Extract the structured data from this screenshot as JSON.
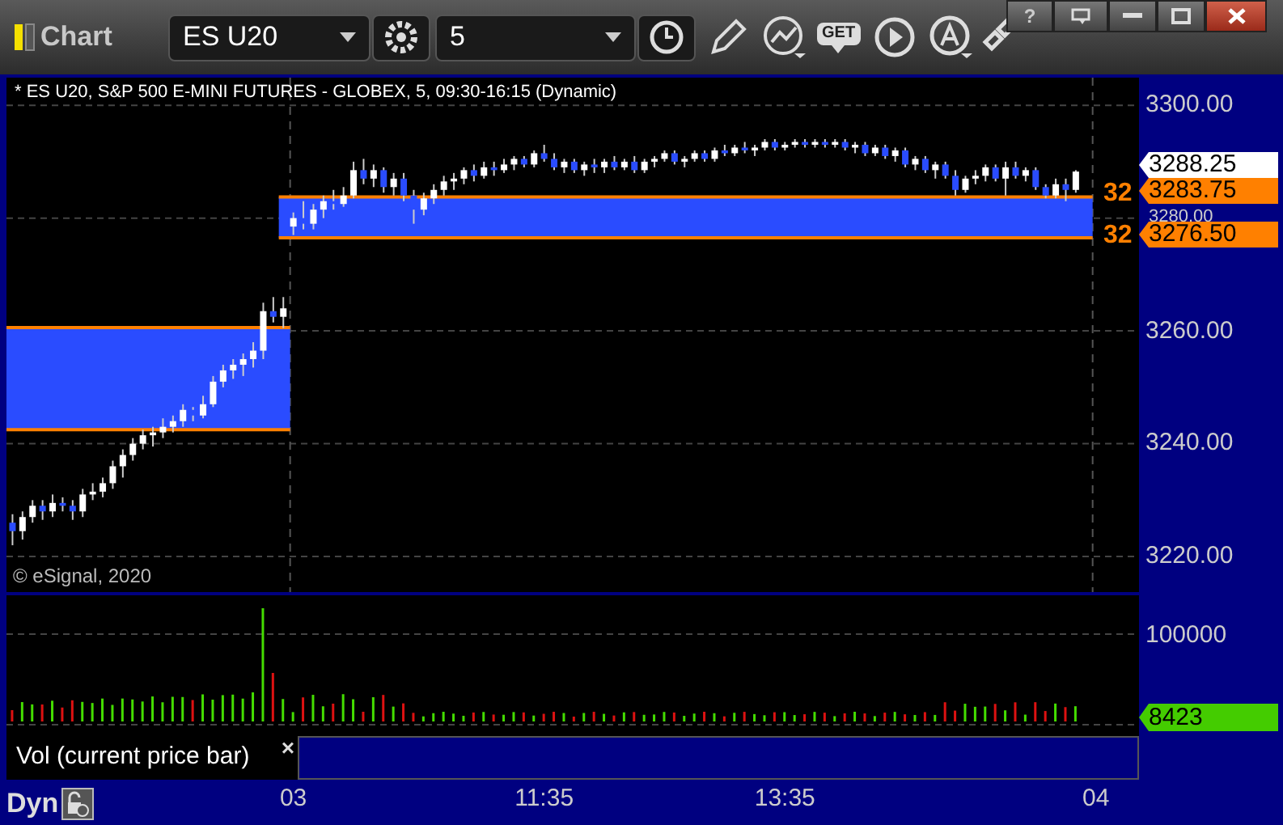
{
  "window": {
    "title": "Chart",
    "help": "?"
  },
  "toolbar": {
    "symbol": "ES U20",
    "interval": "5",
    "get_label": "GET"
  },
  "chart": {
    "legend": "* ES U20, S&P 500 E-MINI FUTURES - GLOBEX, 5, 09:30-16:15 (Dynamic)",
    "copyright": "© eSignal, 2020",
    "chart_data": {
      "type": "candlestick",
      "categories": [
        null,
        null,
        null,
        null,
        null,
        null,
        null,
        null,
        null,
        null,
        null,
        null,
        null,
        null,
        null,
        null,
        null,
        null,
        null,
        null,
        null,
        null,
        null,
        null,
        null,
        null,
        null,
        null,
        null,
        null,
        null,
        null,
        null,
        null,
        null,
        null,
        null,
        null,
        null,
        null,
        null,
        null,
        null,
        null,
        null,
        null,
        null,
        null,
        null,
        null,
        null,
        null,
        null,
        null,
        null,
        null,
        null,
        null,
        null,
        null,
        null,
        null,
        null,
        null,
        null,
        null,
        null,
        null,
        null,
        null,
        null,
        null,
        null,
        null,
        null,
        null,
        null,
        null,
        null,
        null,
        null,
        null,
        null,
        null,
        null,
        null,
        null,
        null,
        null,
        null,
        null,
        null,
        null,
        null,
        null,
        null,
        null,
        null,
        null,
        null,
        null,
        null,
        null,
        null,
        null,
        null,
        null
      ],
      "ohlc": [
        [
          3226,
          3227.5,
          3222,
          3224.5
        ],
        [
          3224.5,
          3228,
          3223,
          3227
        ],
        [
          3227,
          3230,
          3226,
          3229
        ],
        [
          3229,
          3230,
          3226.5,
          3228
        ],
        [
          3228,
          3231,
          3227,
          3229.5
        ],
        [
          3229.5,
          3230.5,
          3228,
          3229
        ],
        [
          3229,
          3230,
          3226.5,
          3228
        ],
        [
          3228,
          3232,
          3227,
          3231
        ],
        [
          3231,
          3233,
          3230,
          3231.5
        ],
        [
          3231.5,
          3234,
          3230.5,
          3233
        ],
        [
          3233,
          3237,
          3232,
          3236
        ],
        [
          3236,
          3239,
          3234,
          3238
        ],
        [
          3238,
          3241,
          3237,
          3240
        ],
        [
          3240,
          3242.5,
          3239,
          3241.5
        ],
        [
          3241.5,
          3243,
          3239.5,
          3242
        ],
        [
          3242,
          3244.5,
          3241,
          3243
        ],
        [
          3243,
          3245,
          3242,
          3244
        ],
        [
          3244,
          3247,
          3243,
          3246
        ],
        [
          3246,
          3246.5,
          3244,
          3245
        ],
        [
          3245,
          3248.5,
          3244.5,
          3247
        ],
        [
          3247,
          3252,
          3246.5,
          3251
        ],
        [
          3251,
          3254,
          3250,
          3253
        ],
        [
          3253,
          3255,
          3251.5,
          3254
        ],
        [
          3254,
          3256,
          3252,
          3255
        ],
        [
          3255,
          3258,
          3253.5,
          3256.5
        ],
        [
          3256.5,
          3265,
          3255,
          3263.5
        ],
        [
          3263.5,
          3266,
          3261.5,
          3262.5
        ],
        [
          3262.5,
          3266,
          3260.5,
          3264
        ],
        [
          3278.5,
          3281,
          3277,
          3280
        ],
        [
          3280,
          3283,
          3278,
          3279
        ],
        [
          3279,
          3282.5,
          3278,
          3281.5
        ],
        [
          3281.5,
          3284,
          3280,
          3283
        ],
        [
          3283,
          3285,
          3281.5,
          3282.5
        ],
        [
          3282.5,
          3285.5,
          3282,
          3284
        ],
        [
          3284,
          3290,
          3283.5,
          3288.5
        ],
        [
          3288.5,
          3290.5,
          3286,
          3287
        ],
        [
          3287,
          3289.5,
          3285.5,
          3288.5
        ],
        [
          3288.5,
          3289,
          3284.5,
          3285.5
        ],
        [
          3285.5,
          3288,
          3284,
          3287
        ],
        [
          3287,
          3288,
          3283,
          3284
        ],
        [
          3284,
          3285,
          3279,
          3281.5
        ],
        [
          3281.5,
          3284.5,
          3280.5,
          3283.5
        ],
        [
          3283.5,
          3286,
          3282.5,
          3285
        ],
        [
          3285,
          3287.5,
          3284,
          3286.5
        ],
        [
          3286.5,
          3288,
          3285,
          3287
        ],
        [
          3287,
          3289,
          3286,
          3288.5
        ],
        [
          3288.5,
          3289.5,
          3286.5,
          3287.5
        ],
        [
          3287.5,
          3290,
          3287,
          3289
        ],
        [
          3289,
          3290,
          3287.5,
          3288.5
        ],
        [
          3288.5,
          3290.5,
          3288,
          3289.5
        ],
        [
          3289.5,
          3291,
          3288.5,
          3290.5
        ],
        [
          3290.5,
          3291,
          3289,
          3289.5
        ],
        [
          3289.5,
          3292,
          3289,
          3291.5
        ],
        [
          3291.5,
          3293,
          3290,
          3290.5
        ],
        [
          3290.5,
          3291.5,
          3288.5,
          3289
        ],
        [
          3289,
          3290.5,
          3288,
          3290
        ],
        [
          3290,
          3290.5,
          3288,
          3288.5
        ],
        [
          3288.5,
          3290,
          3287.5,
          3289.5
        ],
        [
          3289.5,
          3290.5,
          3288,
          3289
        ],
        [
          3289,
          3290.5,
          3288,
          3290
        ],
        [
          3290,
          3291,
          3288.5,
          3289
        ],
        [
          3289,
          3290.5,
          3288.5,
          3290
        ],
        [
          3290,
          3291,
          3288,
          3288.5
        ],
        [
          3288.5,
          3290.5,
          3288,
          3290
        ],
        [
          3290,
          3291,
          3289,
          3290.5
        ],
        [
          3290.5,
          3292,
          3290,
          3291.5
        ],
        [
          3291.5,
          3292,
          3289.5,
          3290
        ],
        [
          3290,
          3291,
          3289,
          3290.5
        ],
        [
          3290.5,
          3292,
          3290,
          3291.5
        ],
        [
          3291.5,
          3292,
          3290,
          3290.5
        ],
        [
          3290.5,
          3292.5,
          3290,
          3292
        ],
        [
          3292,
          3293,
          3291,
          3291.5
        ],
        [
          3291.5,
          3293,
          3291,
          3292.5
        ],
        [
          3292.5,
          3293.5,
          3291.5,
          3292
        ],
        [
          3292,
          3293,
          3291,
          3292.5
        ],
        [
          3292.5,
          3294,
          3292,
          3293.5
        ],
        [
          3293.5,
          3294,
          3292,
          3292.5
        ],
        [
          3292.5,
          3293.5,
          3292,
          3293
        ],
        [
          3293,
          3294,
          3292.5,
          3293.5
        ],
        [
          3293.5,
          3294,
          3292.5,
          3293
        ],
        [
          3293,
          3294,
          3292.5,
          3293.5
        ],
        [
          3293.5,
          3294,
          3292.5,
          3293
        ],
        [
          3293,
          3294,
          3292.5,
          3293.5
        ],
        [
          3293.5,
          3294,
          3292,
          3292.5
        ],
        [
          3292.5,
          3293.5,
          3291.5,
          3293
        ],
        [
          3293,
          3293.5,
          3291,
          3291.5
        ],
        [
          3291.5,
          3293,
          3291,
          3292.5
        ],
        [
          3292.5,
          3293,
          3290.5,
          3291
        ],
        [
          3291,
          3292.5,
          3290,
          3292
        ],
        [
          3292,
          3292.5,
          3289,
          3289.5
        ],
        [
          3289.5,
          3291,
          3288.5,
          3290.5
        ],
        [
          3290.5,
          3291,
          3288,
          3288.5
        ],
        [
          3288.5,
          3290,
          3287,
          3289.5
        ],
        [
          3289.5,
          3290,
          3287,
          3287.5
        ],
        [
          3287.5,
          3288.5,
          3284,
          3285
        ],
        [
          3285,
          3287.5,
          3284.5,
          3287
        ],
        [
          3287,
          3288.5,
          3286,
          3287.5
        ],
        [
          3287.5,
          3289.5,
          3286.5,
          3289
        ],
        [
          3289,
          3289.5,
          3286.5,
          3287
        ],
        [
          3287,
          3290,
          3284,
          3289
        ],
        [
          3289,
          3290,
          3287,
          3287.5
        ],
        [
          3287.5,
          3289,
          3286.5,
          3288.5
        ],
        [
          3288.5,
          3289,
          3285,
          3285.5
        ],
        [
          3285.5,
          3286,
          3283.5,
          3284
        ],
        [
          3284,
          3287,
          3283.5,
          3286
        ],
        [
          3286,
          3287,
          3283,
          3285
        ],
        [
          3285,
          3288.5,
          3284.5,
          3288.25
        ]
      ],
      "ylim": [
        3213.7,
        3304.9
      ],
      "grid": true,
      "yticks": [
        {
          "value": 3300,
          "label": "3300.00"
        },
        {
          "value": 3280,
          "label": "3280.00"
        },
        {
          "value": 3260,
          "label": "3260.00"
        },
        {
          "value": 3240,
          "label": "3240.00"
        },
        {
          "value": 3220,
          "label": "3220.00"
        }
      ]
    },
    "zone_labels": [
      "32",
      "32"
    ],
    "price_markers": [
      {
        "label": "3288.25",
        "color": "#ffffff"
      },
      {
        "label": "3283.75",
        "color": "#ff8000"
      },
      {
        "label": "3276.50",
        "color": "#ff8000"
      }
    ]
  },
  "volume": {
    "tick": "100000",
    "marker": "8423",
    "label": "Vol (current price bar)",
    "close": "×"
  },
  "time_axis": {
    "mode": "Dyn",
    "ticks": [
      "03",
      "11:35",
      "13:35",
      "04"
    ]
  }
}
